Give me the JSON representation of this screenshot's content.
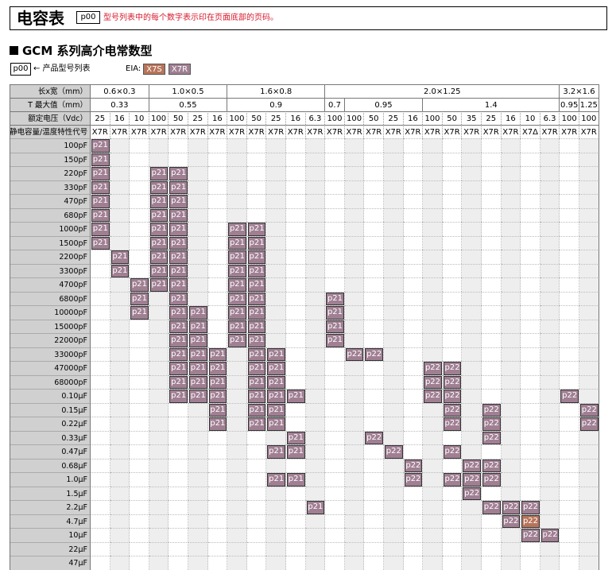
{
  "title": "电容表",
  "title_ref": "p00",
  "title_note": "型号列表中的每个数字表示印在页面底部的页码。",
  "section_title": "GCM 系列高介电常数型",
  "legend": {
    "ref_box": "p00",
    "ref_text": "← 产品型号列表",
    "eia_label": "EIA:",
    "eia_items": [
      {
        "label": "X7S",
        "color": "#b8745a"
      },
      {
        "label": "X7R",
        "color": "#a07f93"
      }
    ]
  },
  "colors": {
    "p21": "#a07f93",
    "p22": "#a07f93",
    "p22_x7delta": "#b8745a",
    "header_bg": "#d0d0d0",
    "stripe": "#eeeeee"
  },
  "header_labels": {
    "size": "长x宽（mm）",
    "thickness": "T 最大值（mm）",
    "voltage": "额定电压（Vdc）",
    "char": "静电容量/温度特性代号"
  },
  "sizes": [
    {
      "label": "0.6×0.3",
      "span": 3
    },
    {
      "label": "1.0×0.5",
      "span": 4
    },
    {
      "label": "1.6×0.8",
      "span": 5
    },
    {
      "label": "2.0×1.25",
      "span": 12
    },
    {
      "label": "3.2×1.6",
      "span": 2
    }
  ],
  "thicknesses": [
    {
      "label": "0.33",
      "span": 3
    },
    {
      "label": "0.55",
      "span": 4
    },
    {
      "label": "0.9",
      "span": 5
    },
    {
      "label": "0.7",
      "span": 1
    },
    {
      "label": "0.95",
      "span": 4
    },
    {
      "label": "1.4",
      "span": 7
    },
    {
      "label": "0.95",
      "span": 1
    },
    {
      "label": "1.25",
      "span": 1
    }
  ],
  "voltages": [
    "25",
    "16",
    "10",
    "100",
    "50",
    "25",
    "16",
    "100",
    "50",
    "25",
    "16",
    "6.3",
    "100",
    "100",
    "50",
    "25",
    "16",
    "100",
    "50",
    "35",
    "25",
    "16",
    "10",
    "6.3",
    "100",
    "100"
  ],
  "chars": [
    "X7R",
    "X7R",
    "X7R",
    "X7R",
    "X7R",
    "X7R",
    "X7R",
    "X7R",
    "X7R",
    "X7R",
    "X7R",
    "X7R",
    "X7R",
    "X7R",
    "X7R",
    "X7R",
    "X7R",
    "X7R",
    "X7R",
    "X7R",
    "X7R",
    "X7R",
    "X7Δ",
    "X7R",
    "X7R",
    "X7R"
  ],
  "capacitances": [
    "100pF",
    "150pF",
    "220pF",
    "330pF",
    "470pF",
    "680pF",
    "1000pF",
    "1500pF",
    "2200pF",
    "3300pF",
    "4700pF",
    "6800pF",
    "10000pF",
    "15000pF",
    "22000pF",
    "33000pF",
    "47000pF",
    "68000pF",
    "0.10μF",
    "0.15μF",
    "0.22μF",
    "0.33μF",
    "0.47μF",
    "0.68μF",
    "1.0μF",
    "1.5μF",
    "2.2μF",
    "4.7μF",
    "10μF",
    "22μF",
    "47μF"
  ],
  "cells": [
    {
      "r": 0,
      "c": 0,
      "v": "p21"
    },
    {
      "r": 1,
      "c": 0,
      "v": "p21"
    },
    {
      "r": 2,
      "c": 0,
      "v": "p21"
    },
    {
      "r": 3,
      "c": 0,
      "v": "p21"
    },
    {
      "r": 4,
      "c": 0,
      "v": "p21"
    },
    {
      "r": 5,
      "c": 0,
      "v": "p21"
    },
    {
      "r": 6,
      "c": 0,
      "v": "p21"
    },
    {
      "r": 7,
      "c": 0,
      "v": "p21"
    },
    {
      "r": 8,
      "c": 1,
      "v": "p21"
    },
    {
      "r": 9,
      "c": 1,
      "v": "p21"
    },
    {
      "r": 10,
      "c": 2,
      "v": "p21"
    },
    {
      "r": 11,
      "c": 2,
      "v": "p21"
    },
    {
      "r": 12,
      "c": 2,
      "v": "p21"
    },
    {
      "r": 2,
      "c": 3,
      "v": "p21"
    },
    {
      "r": 3,
      "c": 3,
      "v": "p21"
    },
    {
      "r": 4,
      "c": 3,
      "v": "p21"
    },
    {
      "r": 5,
      "c": 3,
      "v": "p21"
    },
    {
      "r": 6,
      "c": 3,
      "v": "p21"
    },
    {
      "r": 7,
      "c": 3,
      "v": "p21"
    },
    {
      "r": 8,
      "c": 3,
      "v": "p21"
    },
    {
      "r": 9,
      "c": 3,
      "v": "p21"
    },
    {
      "r": 10,
      "c": 3,
      "v": "p21"
    },
    {
      "r": 2,
      "c": 4,
      "v": "p21"
    },
    {
      "r": 3,
      "c": 4,
      "v": "p21"
    },
    {
      "r": 4,
      "c": 4,
      "v": "p21"
    },
    {
      "r": 5,
      "c": 4,
      "v": "p21"
    },
    {
      "r": 6,
      "c": 4,
      "v": "p21"
    },
    {
      "r": 7,
      "c": 4,
      "v": "p21"
    },
    {
      "r": 8,
      "c": 4,
      "v": "p21"
    },
    {
      "r": 9,
      "c": 4,
      "v": "p21"
    },
    {
      "r": 10,
      "c": 4,
      "v": "p21"
    },
    {
      "r": 11,
      "c": 4,
      "v": "p21"
    },
    {
      "r": 12,
      "c": 4,
      "v": "p21"
    },
    {
      "r": 13,
      "c": 4,
      "v": "p21"
    },
    {
      "r": 14,
      "c": 4,
      "v": "p21"
    },
    {
      "r": 15,
      "c": 4,
      "v": "p21"
    },
    {
      "r": 16,
      "c": 4,
      "v": "p21"
    },
    {
      "r": 17,
      "c": 4,
      "v": "p21"
    },
    {
      "r": 18,
      "c": 4,
      "v": "p21"
    },
    {
      "r": 12,
      "c": 5,
      "v": "p21"
    },
    {
      "r": 13,
      "c": 5,
      "v": "p21"
    },
    {
      "r": 14,
      "c": 5,
      "v": "p21"
    },
    {
      "r": 15,
      "c": 5,
      "v": "p21"
    },
    {
      "r": 16,
      "c": 5,
      "v": "p21"
    },
    {
      "r": 17,
      "c": 5,
      "v": "p21"
    },
    {
      "r": 18,
      "c": 5,
      "v": "p21"
    },
    {
      "r": 15,
      "c": 6,
      "v": "p21"
    },
    {
      "r": 16,
      "c": 6,
      "v": "p21"
    },
    {
      "r": 17,
      "c": 6,
      "v": "p21"
    },
    {
      "r": 18,
      "c": 6,
      "v": "p21"
    },
    {
      "r": 19,
      "c": 6,
      "v": "p21"
    },
    {
      "r": 20,
      "c": 6,
      "v": "p21"
    },
    {
      "r": 6,
      "c": 7,
      "v": "p21"
    },
    {
      "r": 7,
      "c": 7,
      "v": "p21"
    },
    {
      "r": 8,
      "c": 7,
      "v": "p21"
    },
    {
      "r": 9,
      "c": 7,
      "v": "p21"
    },
    {
      "r": 10,
      "c": 7,
      "v": "p21"
    },
    {
      "r": 11,
      "c": 7,
      "v": "p21"
    },
    {
      "r": 12,
      "c": 7,
      "v": "p21"
    },
    {
      "r": 13,
      "c": 7,
      "v": "p21"
    },
    {
      "r": 14,
      "c": 7,
      "v": "p21"
    },
    {
      "r": 6,
      "c": 8,
      "v": "p21"
    },
    {
      "r": 7,
      "c": 8,
      "v": "p21"
    },
    {
      "r": 8,
      "c": 8,
      "v": "p21"
    },
    {
      "r": 9,
      "c": 8,
      "v": "p21"
    },
    {
      "r": 10,
      "c": 8,
      "v": "p21"
    },
    {
      "r": 11,
      "c": 8,
      "v": "p21"
    },
    {
      "r": 12,
      "c": 8,
      "v": "p21"
    },
    {
      "r": 13,
      "c": 8,
      "v": "p21"
    },
    {
      "r": 14,
      "c": 8,
      "v": "p21"
    },
    {
      "r": 15,
      "c": 8,
      "v": "p21"
    },
    {
      "r": 16,
      "c": 8,
      "v": "p21"
    },
    {
      "r": 17,
      "c": 8,
      "v": "p21"
    },
    {
      "r": 18,
      "c": 8,
      "v": "p21"
    },
    {
      "r": 19,
      "c": 8,
      "v": "p21"
    },
    {
      "r": 20,
      "c": 8,
      "v": "p21"
    },
    {
      "r": 15,
      "c": 9,
      "v": "p21"
    },
    {
      "r": 16,
      "c": 9,
      "v": "p21"
    },
    {
      "r": 17,
      "c": 9,
      "v": "p21"
    },
    {
      "r": 18,
      "c": 9,
      "v": "p21"
    },
    {
      "r": 19,
      "c": 9,
      "v": "p21"
    },
    {
      "r": 20,
      "c": 9,
      "v": "p21"
    },
    {
      "r": 22,
      "c": 9,
      "v": "p21"
    },
    {
      "r": 24,
      "c": 9,
      "v": "p21"
    },
    {
      "r": 18,
      "c": 10,
      "v": "p21"
    },
    {
      "r": 21,
      "c": 10,
      "v": "p21"
    },
    {
      "r": 22,
      "c": 10,
      "v": "p21"
    },
    {
      "r": 24,
      "c": 10,
      "v": "p21"
    },
    {
      "r": 26,
      "c": 11,
      "v": "p21"
    },
    {
      "r": 11,
      "c": 12,
      "v": "p21"
    },
    {
      "r": 12,
      "c": 12,
      "v": "p21"
    },
    {
      "r": 13,
      "c": 12,
      "v": "p21"
    },
    {
      "r": 14,
      "c": 12,
      "v": "p21"
    },
    {
      "r": 15,
      "c": 13,
      "v": "p22"
    },
    {
      "r": 15,
      "c": 14,
      "v": "p22"
    },
    {
      "r": 21,
      "c": 14,
      "v": "p22"
    },
    {
      "r": 22,
      "c": 15,
      "v": "p22"
    },
    {
      "r": 23,
      "c": 16,
      "v": "p22"
    },
    {
      "r": 24,
      "c": 16,
      "v": "p22"
    },
    {
      "r": 16,
      "c": 17,
      "v": "p22"
    },
    {
      "r": 17,
      "c": 17,
      "v": "p22"
    },
    {
      "r": 18,
      "c": 17,
      "v": "p22"
    },
    {
      "r": 16,
      "c": 18,
      "v": "p22"
    },
    {
      "r": 17,
      "c": 18,
      "v": "p22"
    },
    {
      "r": 18,
      "c": 18,
      "v": "p22"
    },
    {
      "r": 19,
      "c": 18,
      "v": "p22"
    },
    {
      "r": 20,
      "c": 18,
      "v": "p22"
    },
    {
      "r": 22,
      "c": 18,
      "v": "p22"
    },
    {
      "r": 24,
      "c": 18,
      "v": "p22"
    },
    {
      "r": 23,
      "c": 19,
      "v": "p22"
    },
    {
      "r": 24,
      "c": 19,
      "v": "p22"
    },
    {
      "r": 25,
      "c": 19,
      "v": "p22"
    },
    {
      "r": 19,
      "c": 20,
      "v": "p22"
    },
    {
      "r": 20,
      "c": 20,
      "v": "p22"
    },
    {
      "r": 21,
      "c": 20,
      "v": "p22"
    },
    {
      "r": 23,
      "c": 20,
      "v": "p22"
    },
    {
      "r": 24,
      "c": 20,
      "v": "p22"
    },
    {
      "r": 26,
      "c": 20,
      "v": "p22"
    },
    {
      "r": 26,
      "c": 21,
      "v": "p22"
    },
    {
      "r": 27,
      "c": 21,
      "v": "p22"
    },
    {
      "r": 26,
      "c": 22,
      "v": "p22"
    },
    {
      "r": 27,
      "c": 22,
      "v": "p22",
      "x7s": true
    },
    {
      "r": 28,
      "c": 22,
      "v": "p22"
    },
    {
      "r": 28,
      "c": 23,
      "v": "p22"
    },
    {
      "r": 18,
      "c": 24,
      "v": "p22"
    },
    {
      "r": 19,
      "c": 25,
      "v": "p22"
    },
    {
      "r": 20,
      "c": 25,
      "v": "p22"
    }
  ]
}
